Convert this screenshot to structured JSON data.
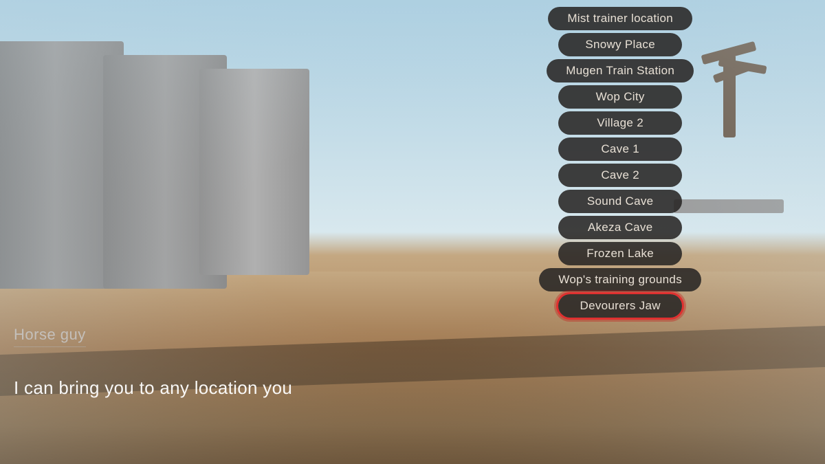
{
  "scene": {
    "npc_name": "Horse guy",
    "dialogue": "I can bring you to any location you"
  },
  "menu": {
    "items": [
      {
        "id": "mist-trainer",
        "label": "Mist trainer location",
        "highlighted": false
      },
      {
        "id": "snowy-place",
        "label": "Snowy Place",
        "highlighted": false
      },
      {
        "id": "mugen-train",
        "label": "Mugen Train Station",
        "highlighted": false
      },
      {
        "id": "wop-city",
        "label": "Wop City",
        "highlighted": false
      },
      {
        "id": "village-2",
        "label": "Village 2",
        "highlighted": false
      },
      {
        "id": "cave-1",
        "label": "Cave 1",
        "highlighted": false
      },
      {
        "id": "cave-2",
        "label": "Cave 2",
        "highlighted": false
      },
      {
        "id": "sound-cave",
        "label": "Sound Cave",
        "highlighted": false
      },
      {
        "id": "akeza-cave",
        "label": "Akeza Cave",
        "highlighted": false
      },
      {
        "id": "frozen-lake",
        "label": "Frozen Lake",
        "highlighted": false
      },
      {
        "id": "wops-training",
        "label": "Wop's training grounds",
        "highlighted": false
      },
      {
        "id": "devourers-jaw",
        "label": "Devourers Jaw",
        "highlighted": true
      }
    ]
  }
}
